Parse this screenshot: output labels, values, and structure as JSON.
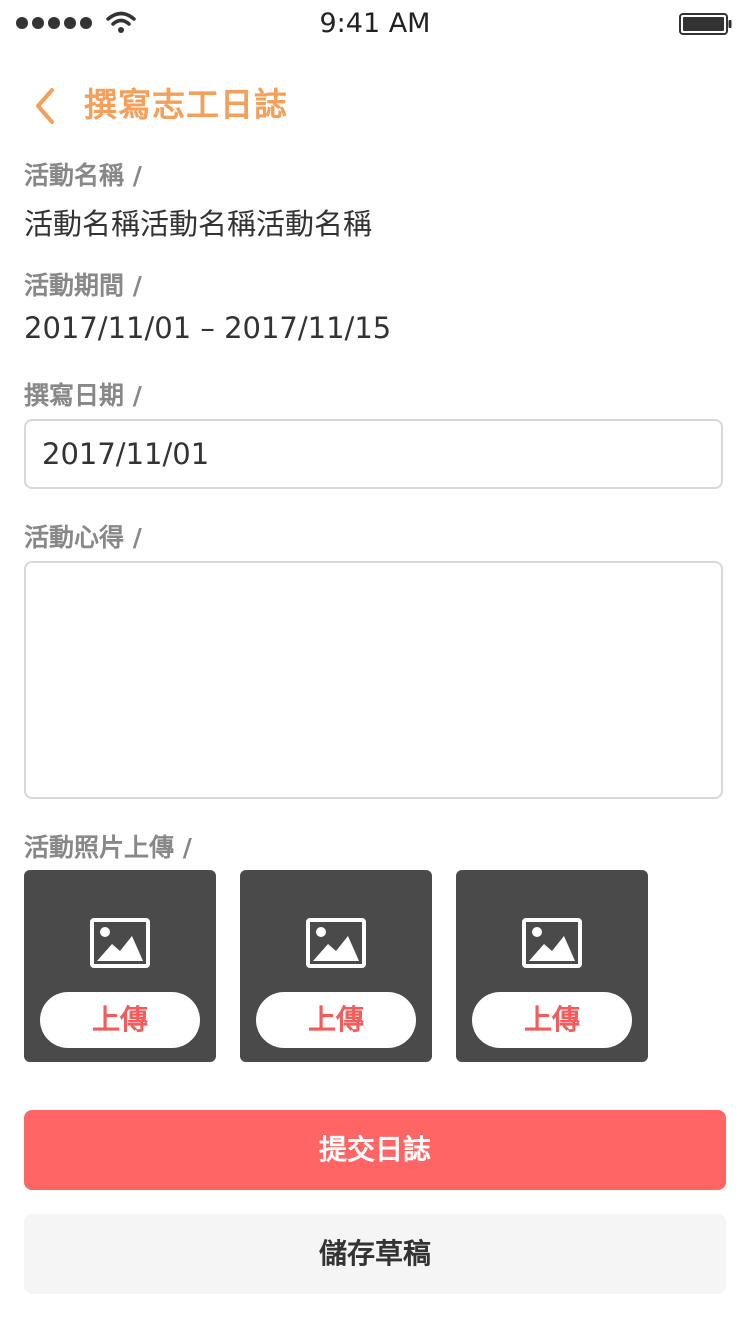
{
  "status_bar": {
    "time": "9:41 AM",
    "signal_icon": "signal-dots-icon",
    "wifi_icon": "wifi-icon",
    "battery_icon": "battery-icon"
  },
  "header": {
    "title": "撰寫志工日誌",
    "back_icon": "chevron-left-icon",
    "accent_color": "#f5a05a"
  },
  "form": {
    "activity_name_label": "活動名稱 /",
    "activity_name_value": "活動名稱活動名稱活動名稱",
    "period_label": "活動期間 /",
    "period_value": "2017/11/01 – 2017/11/15",
    "write_date_label": "撰寫日期 /",
    "write_date_value": "2017/11/01",
    "reflection_label": "活動心得 /",
    "reflection_value": "",
    "photos_label": "活動照片上傳 /",
    "photo_slots": [
      {
        "icon": "image-icon",
        "upload_label": "上傳"
      },
      {
        "icon": "image-icon",
        "upload_label": "上傳"
      },
      {
        "icon": "image-icon",
        "upload_label": "上傳"
      }
    ]
  },
  "actions": {
    "submit_label": "提交日誌",
    "submit_color": "#ff6565",
    "draft_label": "儲存草稿"
  }
}
